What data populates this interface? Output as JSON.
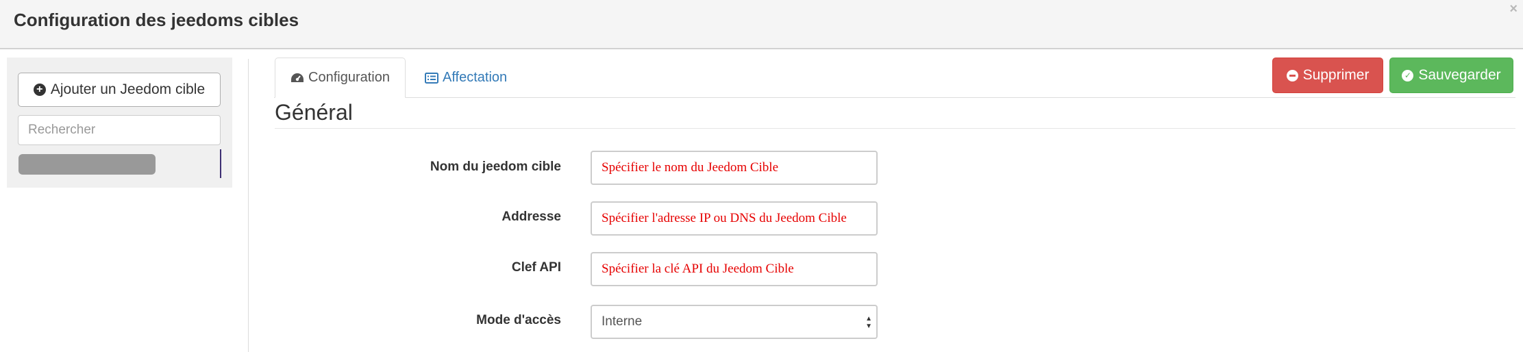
{
  "header": {
    "title": "Configuration des jeedoms cibles",
    "close_glyph": "×"
  },
  "sidebar": {
    "add_button_label": "Ajouter un Jeedom cible",
    "add_icon": "plus-circle-icon",
    "search_placeholder": "Rechercher"
  },
  "tabs": [
    {
      "label": "Configuration",
      "icon": "dashboard-icon"
    },
    {
      "label": "Affectation",
      "icon": "list-alt-icon"
    }
  ],
  "toolbar": {
    "delete_label": "Supprimer",
    "save_label": "Sauvegarder",
    "delete_color": "#d9534f",
    "save_color": "#5cb85c"
  },
  "section": {
    "title": "Général"
  },
  "form": {
    "name": {
      "label": "Nom du jeedom cible",
      "placeholder": "Spécifier le nom du Jeedom Cible"
    },
    "address": {
      "label": "Addresse",
      "placeholder": "Spécifier l'adresse IP ou DNS du Jeedom Cible"
    },
    "apikey": {
      "label": "Clef API",
      "placeholder": "Spécifier la clé API du Jeedom Cible"
    },
    "mode": {
      "label": "Mode d'accès",
      "value": "Interne"
    }
  }
}
